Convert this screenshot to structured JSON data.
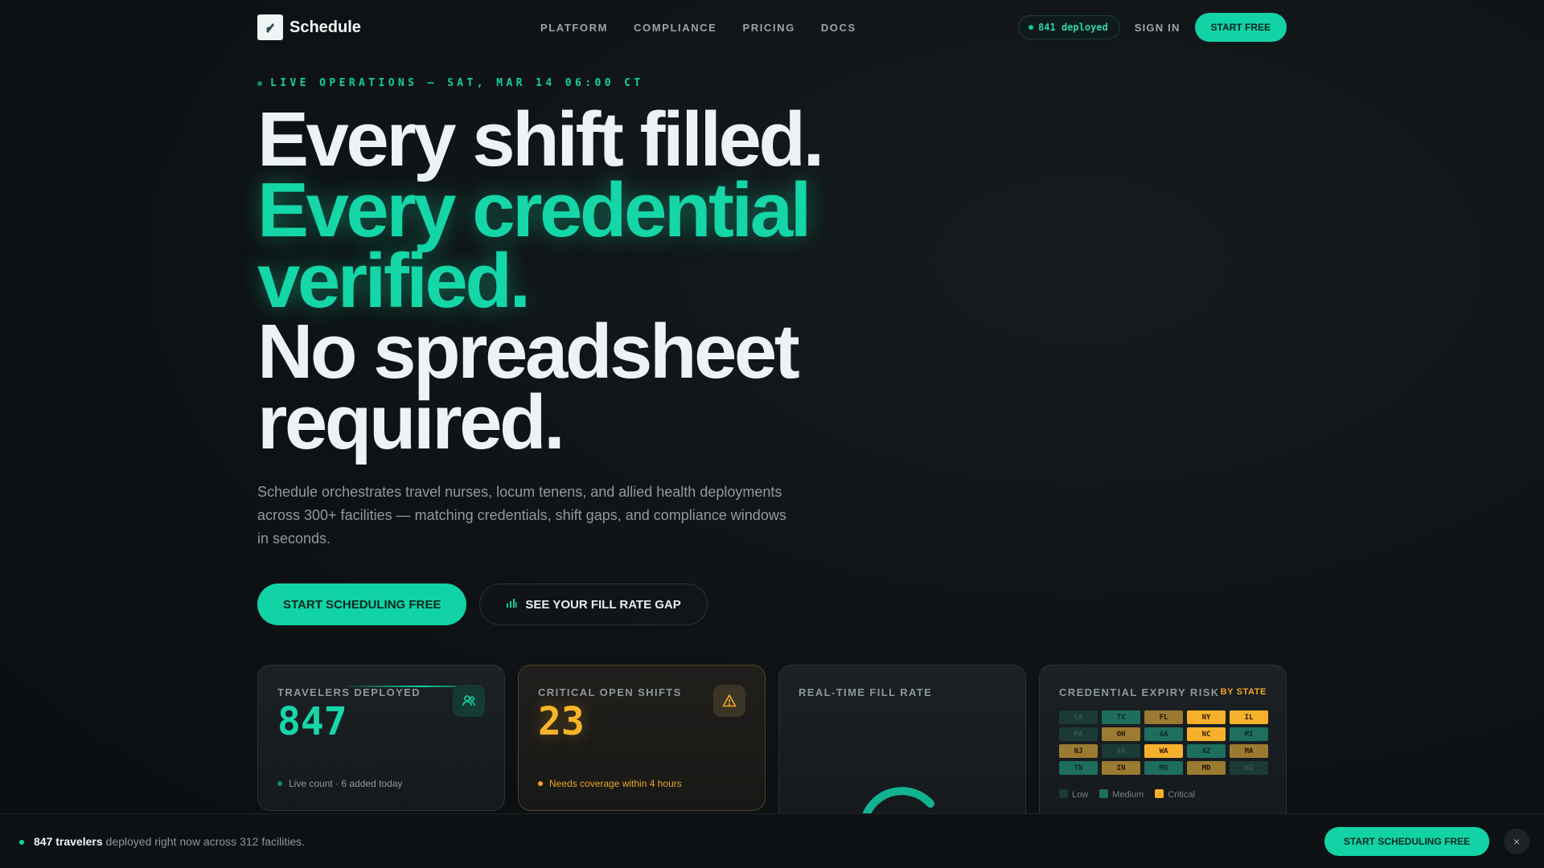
{
  "nav": {
    "brand": "Schedule",
    "links": [
      "PLATFORM",
      "COMPLIANCE",
      "PRICING",
      "DOCS"
    ],
    "deployed_pill": "841 deployed",
    "sign_in": "SIGN IN",
    "start_free": "START FREE"
  },
  "hero": {
    "live_label": "LIVE OPERATIONS — SAT, MAR 14 06:00 CT",
    "headline_line1": "Every shift filled.",
    "headline_line2": "Every credential",
    "headline_line3": "verified.",
    "headline_line4": "No spreadsheet",
    "headline_line5": "required.",
    "subtitle": "Schedule orchestrates travel nurses, locum tenens, and allied health deployments across 300+ facilities — matching credentials, shift gaps, and compliance windows in seconds.",
    "cta_primary": "START SCHEDULING FREE",
    "cta_secondary": "SEE YOUR FILL RATE GAP"
  },
  "cards": {
    "travelers": {
      "label": "TRAVELERS DEPLOYED",
      "value": "847",
      "footer": "Live count · 6 added today",
      "icon": "users-icon"
    },
    "critical": {
      "label": "CRITICAL OPEN SHIFTS",
      "value": "23",
      "footer": "Needs coverage within 4 hours",
      "icon": "warning-icon"
    },
    "fill_rate": {
      "label": "REAL-TIME FILL RATE"
    },
    "expiry": {
      "label": "CREDENTIAL EXPIRY RISK",
      "by_state": "BY STATE",
      "states": [
        {
          "code": "CA",
          "level": "low"
        },
        {
          "code": "TX",
          "level": "med"
        },
        {
          "code": "FL",
          "level": "warn"
        },
        {
          "code": "NY",
          "level": "crit"
        },
        {
          "code": "IL",
          "level": "crit"
        },
        {
          "code": "PA",
          "level": "low"
        },
        {
          "code": "OH",
          "level": "warn"
        },
        {
          "code": "GA",
          "level": "med"
        },
        {
          "code": "NC",
          "level": "crit"
        },
        {
          "code": "MI",
          "level": "med"
        },
        {
          "code": "NJ",
          "level": "warn"
        },
        {
          "code": "VA",
          "level": "low"
        },
        {
          "code": "WA",
          "level": "crit"
        },
        {
          "code": "AZ",
          "level": "med"
        },
        {
          "code": "MA",
          "level": "warn"
        },
        {
          "code": "TN",
          "level": "med"
        },
        {
          "code": "IN",
          "level": "warn"
        },
        {
          "code": "MO",
          "level": "med"
        },
        {
          "code": "MD",
          "level": "warn"
        },
        {
          "code": "WI",
          "level": "low"
        }
      ],
      "legend": [
        "Low",
        "Medium",
        "Critical"
      ]
    }
  },
  "bottom_bar": {
    "bold": "847 travelers",
    "text": " deployed right now across 312 facilities.",
    "cta": "START SCHEDULING FREE",
    "close": "×"
  },
  "colors": {
    "accent": "#12d3a6",
    "warning": "#f5a623",
    "background": "#0e1214"
  }
}
